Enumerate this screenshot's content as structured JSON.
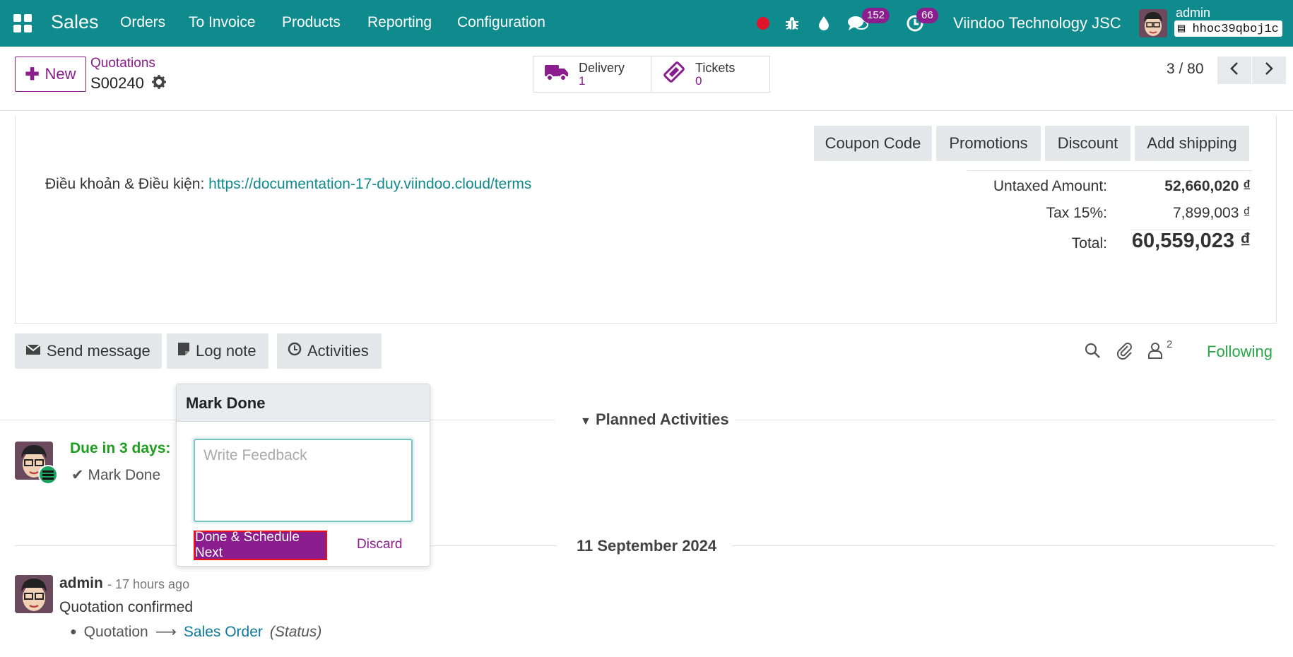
{
  "topbar": {
    "app_name": "Sales",
    "menu": [
      "Orders",
      "To Invoice",
      "Products",
      "Reporting",
      "Configuration"
    ],
    "messages_count": "152",
    "activities_count": "66",
    "company": "Viindoo Technology JSC",
    "user": "admin",
    "database": "hhoc39qboj1c"
  },
  "control_panel": {
    "new_label": "New",
    "breadcrumb": "Quotations",
    "record_name": "S00240",
    "smart_buttons": [
      {
        "label": "Delivery",
        "count": "1"
      },
      {
        "label": "Tickets",
        "count": "0"
      }
    ],
    "pager": "3 / 80"
  },
  "sheet": {
    "buttons": [
      "Coupon Code",
      "Promotions",
      "Discount",
      "Add shipping"
    ],
    "terms_label": "Điều khoản & Điều kiện:",
    "terms_url": "https://documentation-17-duy.viindoo.cloud/terms",
    "totals": {
      "untaxed_label": "Untaxed Amount:",
      "untaxed_value": "52,660,020 ₫",
      "tax_label": "Tax 15%:",
      "tax_value": "7,899,003 ₫",
      "total_label": "Total:",
      "total_value": "60,559,023 ₫"
    }
  },
  "chatter": {
    "send_message": "Send message",
    "log_note": "Log note",
    "activities": "Activities",
    "followers_count": "2",
    "following": "Following",
    "planned_title": "Planned Activities",
    "activity": {
      "due": "Due in 3 days:",
      "mark_done": "Mark Done"
    },
    "date_separator": "11 September 2024",
    "message": {
      "author": "admin",
      "time": "- 17 hours ago",
      "body": "Quotation confirmed",
      "old_value": "Quotation",
      "new_value": "Sales Order",
      "field": "(Status)"
    }
  },
  "popover": {
    "title": "Mark Done",
    "placeholder": "Write Feedback",
    "done_button": "Done & Schedule Next",
    "discard": "Discard"
  },
  "colors": {
    "topbar": "#0f8b8d",
    "accent": "#8b1d8f",
    "following": "#28a745"
  }
}
